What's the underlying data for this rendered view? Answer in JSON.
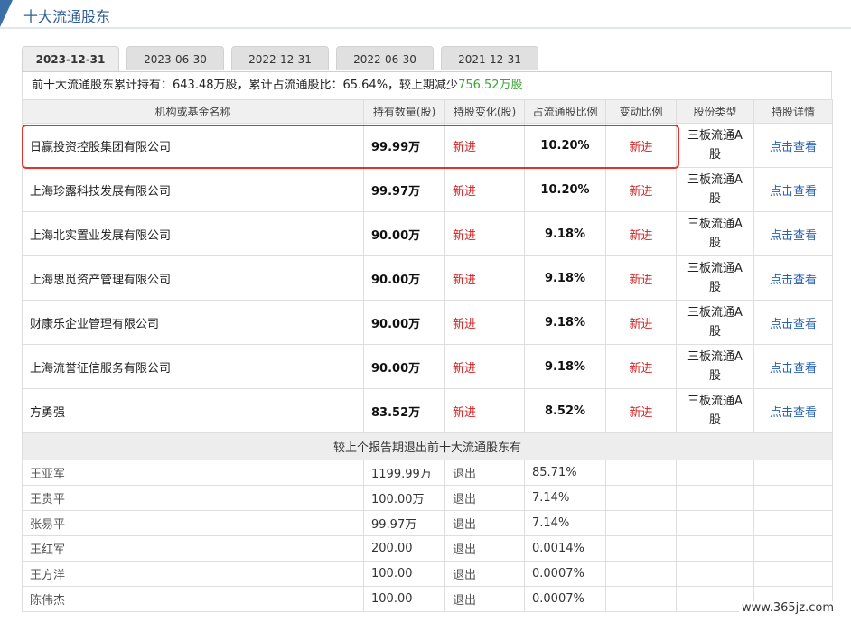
{
  "header": {
    "title": "十大流通股东"
  },
  "tabs": [
    {
      "label": "2023-12-31",
      "active": true
    },
    {
      "label": "2023-06-30",
      "active": false
    },
    {
      "label": "2022-12-31",
      "active": false
    },
    {
      "label": "2022-06-30",
      "active": false
    },
    {
      "label": "2021-12-31",
      "active": false
    }
  ],
  "summary": {
    "prefix": "前十大流通股东累计持有：643.48万股，累计占流通股比：65.64%，较上期减少",
    "change": "756.52万股"
  },
  "table": {
    "headers": [
      "机构或基金名称",
      "持有数量(股)",
      "持股变化(股)",
      "占流通股比例",
      "变动比例",
      "股份类型",
      "持股详情"
    ],
    "rows": [
      {
        "name": "日赢投资控股集团有限公司",
        "qty": "99.99万",
        "change": "新进",
        "ratio": "10.20%",
        "vary": "新进",
        "type_line1": "三板流通A",
        "type_line2": "股",
        "detail": "点击查看"
      },
      {
        "name": "上海珍露科技发展有限公司",
        "qty": "99.97万",
        "change": "新进",
        "ratio": "10.20%",
        "vary": "新进",
        "type_line1": "三板流通A",
        "type_line2": "股",
        "detail": "点击查看"
      },
      {
        "name": "上海北实置业发展有限公司",
        "qty": "90.00万",
        "change": "新进",
        "ratio": "9.18%",
        "vary": "新进",
        "type_line1": "三板流通A",
        "type_line2": "股",
        "detail": "点击查看"
      },
      {
        "name": "上海思觅资产管理有限公司",
        "qty": "90.00万",
        "change": "新进",
        "ratio": "9.18%",
        "vary": "新进",
        "type_line1": "三板流通A",
        "type_line2": "股",
        "detail": "点击查看"
      },
      {
        "name": "财康乐企业管理有限公司",
        "qty": "90.00万",
        "change": "新进",
        "ratio": "9.18%",
        "vary": "新进",
        "type_line1": "三板流通A",
        "type_line2": "股",
        "detail": "点击查看"
      },
      {
        "name": "上海流誉征信服务有限公司",
        "qty": "90.00万",
        "change": "新进",
        "ratio": "9.18%",
        "vary": "新进",
        "type_line1": "三板流通A",
        "type_line2": "股",
        "detail": "点击查看"
      },
      {
        "name": "方勇强",
        "qty": "83.52万",
        "change": "新进",
        "ratio": "8.52%",
        "vary": "新进",
        "type_line1": "三板流通A",
        "type_line2": "股",
        "detail": "点击查看"
      }
    ],
    "exit_caption": "较上个报告期退出前十大流通股东有",
    "exits": [
      {
        "name": "王亚军",
        "qty": "1199.99万",
        "change": "退出",
        "ratio": "85.71%"
      },
      {
        "name": "王贵平",
        "qty": "100.00万",
        "change": "退出",
        "ratio": "7.14%"
      },
      {
        "name": "张易平",
        "qty": "99.97万",
        "change": "退出",
        "ratio": "7.14%"
      },
      {
        "name": "王红军",
        "qty": "200.00",
        "change": "退出",
        "ratio": "0.0014%"
      },
      {
        "name": "王方洋",
        "qty": "100.00",
        "change": "退出",
        "ratio": "0.0007%"
      },
      {
        "name": "陈伟杰",
        "qty": "100.00",
        "change": "退出",
        "ratio": "0.0007%"
      }
    ]
  },
  "watermark": "www.365jz.com",
  "colors": {
    "accent": "#2c5d95",
    "up": "#d12222",
    "green": "#39a535",
    "link": "#2a62b0",
    "highlight": "#e5302b"
  }
}
